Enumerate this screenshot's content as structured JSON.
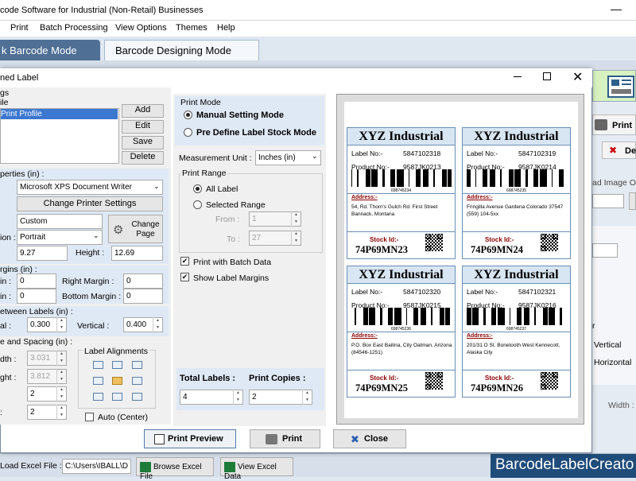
{
  "app": {
    "title": "code Software for Industrial (Non-Retail) Businesses",
    "minimize": "—"
  },
  "menu": [
    "Print",
    "Batch Processing",
    "View Options",
    "Themes",
    "Help"
  ],
  "tabs": {
    "quick": "k Barcode Mode",
    "design": "Barcode Designing Mode"
  },
  "right": {
    "print": "Print",
    "delete": "De",
    "load_image": "ad Image O",
    "vertical": "Vertical",
    "horizontal": "Horizontal",
    "r": "r",
    "width": "Width :"
  },
  "bottom": {
    "load_excel": "Load Excel File :",
    "excel_path": "C:\\Users\\IBALL\\D",
    "browse": "Browse Excel File",
    "view": "View Excel Data",
    "brand": "BarcodeLabelCreato"
  },
  "dialog": {
    "title": "ned Label",
    "settings_frag": "gs",
    "file_frag": "ile",
    "profile": "Print Profile",
    "add": "Add",
    "edit": "Edit",
    "save": "Save",
    "delete": "Delete",
    "props_title": "perties (in) :",
    "printer": "Microsoft XPS Document Writer",
    "change_settings": "Change Printer Settings",
    "paper": "Custom",
    "orient_label": "ion :",
    "orientation": "Portrait",
    "change_page": "Change Page",
    "width": "9.27",
    "height_label": "Height :",
    "height": "12.69",
    "margins_title": "rgins (in) :",
    "left_label": "in :",
    "left": "0",
    "top_label": "in :",
    "top": "0",
    "right_label": "Right Margin :",
    "right": "0",
    "bottom_label": "Bottom Margin :",
    "bottom": "0",
    "between_title": "etween Labels (in) :",
    "horiz_label": "al :",
    "horiz": "0.300",
    "vert_label": "Vertical :",
    "vert": "0.400",
    "size_title": "e and Spacing (in) :",
    "width_label": "dth :",
    "label_width": "3.031",
    "height2_label": "ght :",
    "label_height": "3.812",
    "rows": "2",
    "cols": "2",
    "align_title": "Label Alignments",
    "auto_center": "Auto (Center)",
    "print_mode": "Print Mode",
    "manual": "Manual Setting Mode",
    "predefine": "Pre Define Label Stock Mode",
    "unit_label": "Measurement Unit :",
    "unit": "Inches (in)",
    "range_title": "Print Range",
    "all": "All Label",
    "selected": "Selected Range",
    "from_label": "From :",
    "from": "1",
    "to_label": "To :",
    "to": "27",
    "batch": "Print with Batch Data",
    "show_margins": "Show Label Margins",
    "total_label": "Total Labels :",
    "total": "4",
    "copies_label": "Print Copies :",
    "copies": "2",
    "preview_btn": "Print Preview",
    "print_btn": "Print",
    "close_btn": "Close"
  },
  "labels": [
    {
      "title": "XYZ Industrial",
      "label_no_key": "Label No:-",
      "label_no": "5847102318",
      "product_key": "Product No:-",
      "product": "9587JK0213",
      "bc_num": "698745234",
      "addr_key": "Address:-",
      "addr": "54, Rd. Thorn's Gulch Rd. First Street Bannack, Montana",
      "stock_key": "Stock Id:-",
      "stock": "74P69MN23"
    },
    {
      "title": "XYZ Industrial",
      "label_no_key": "Label No:-",
      "label_no": "5847102319",
      "product_key": "Product No:-",
      "product": "9587JK0214",
      "bc_num": "698745235",
      "addr_key": "Address:-",
      "addr": "Fringilla Avenue Gardena Colorado 37547 (559) 104-5xx",
      "stock_key": "Stock Id:-",
      "stock": "74P69MN24"
    },
    {
      "title": "XYZ Industrial",
      "label_no_key": "Label No:-",
      "label_no": "5847102320",
      "product_key": "Product No:-",
      "product": "9587JK0215",
      "bc_num": "698745236",
      "addr_key": "Address:-",
      "addr": "P.O. Box East Bailina, City Oatman, Arizona (84546-1251)",
      "stock_key": "Stock Id:-",
      "stock": "74P69MN25"
    },
    {
      "title": "XYZ Industrial",
      "label_no_key": "Label No:-",
      "label_no": "5847102321",
      "product_key": "Product No:-",
      "product": "9587JK0216",
      "bc_num": "698745237",
      "addr_key": "Address:-",
      "addr": "201/31 O St. Bonetooth West Kennecott, Alaska City",
      "stock_key": "Stock Id:-",
      "stock": "74P69MN26"
    }
  ]
}
